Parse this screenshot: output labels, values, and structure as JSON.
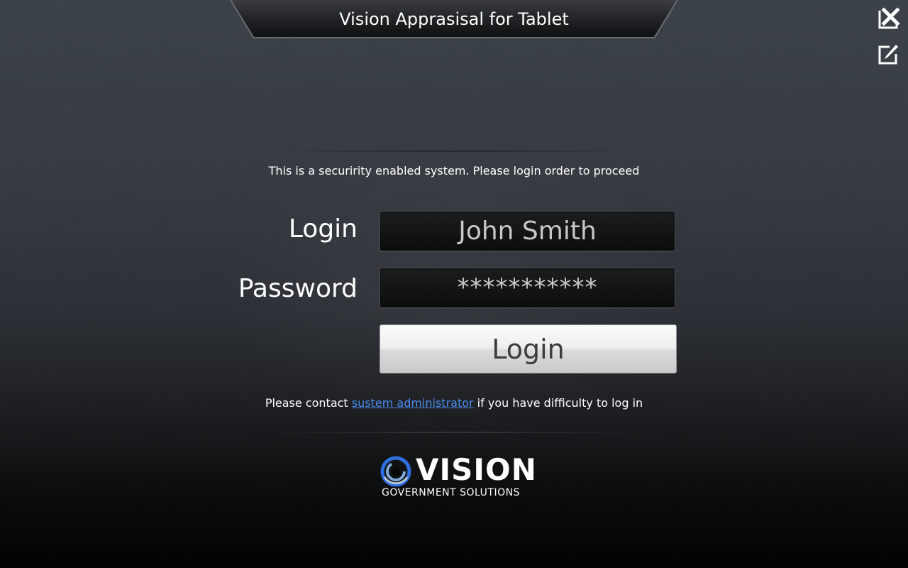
{
  "header": {
    "title": "Vision Apprasisal for Tablet"
  },
  "toolbar": {
    "close_icon": "close-x-icon",
    "edit_icon": "edit-pencil-icon"
  },
  "login_form": {
    "notice": "This is a securirity enabled system. Please login order to proceed",
    "login_label": "Login",
    "login_value": "John Smith",
    "password_label": "Password",
    "password_value": "***********",
    "submit_label": "Login"
  },
  "contact": {
    "prefix": "Please contact ",
    "link_text": "sustem administrator",
    "suffix": " if you have difficulty to log in"
  },
  "logo": {
    "wordmark": "VISION",
    "subtitle": "GOVERNMENT SOLUTIONS"
  },
  "colors": {
    "link": "#4a8cf2",
    "logo_blue": "#2f6fe0"
  }
}
